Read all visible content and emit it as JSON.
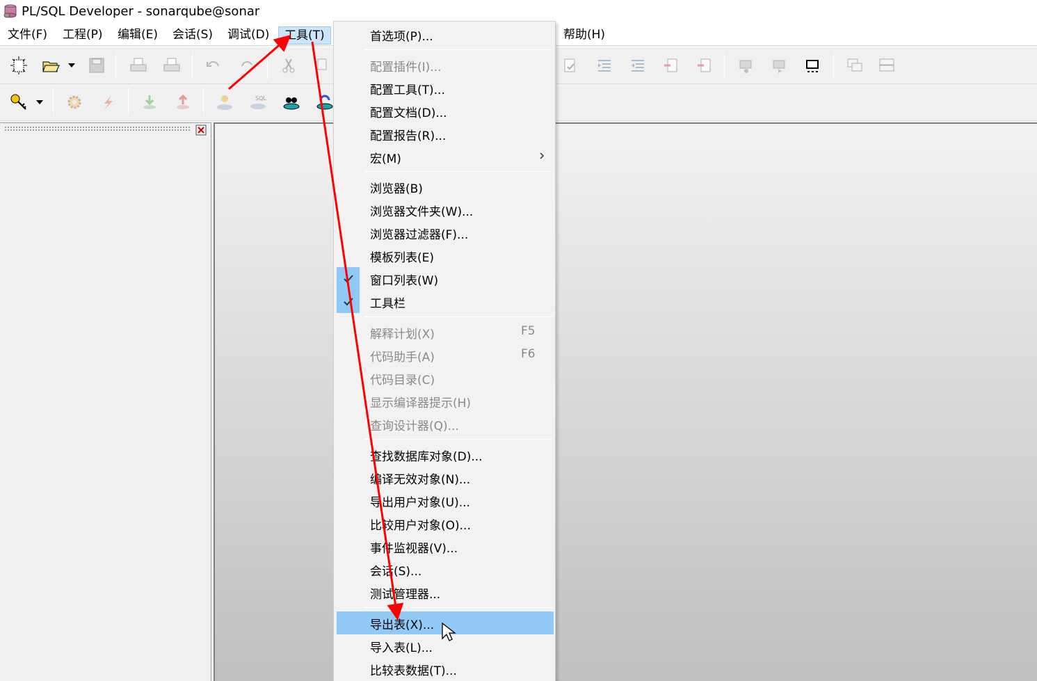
{
  "window": {
    "title": "PL/SQL Developer - sonarqube@sonar"
  },
  "menubar": {
    "items": [
      "文件(F)",
      "工程(P)",
      "编辑(E)",
      "会话(S)",
      "调试(D)",
      "工具(T)",
      "帮助(H)"
    ]
  },
  "tools_menu": {
    "items": [
      {
        "label": "首选项(P)...",
        "enabled": true
      },
      {
        "label": "配置插件(I)...",
        "enabled": false
      },
      {
        "label": "配置工具(T)...",
        "enabled": true
      },
      {
        "label": "配置文档(D)...",
        "enabled": true
      },
      {
        "label": "配置报告(R)...",
        "enabled": true
      },
      {
        "label": "宏(M)",
        "enabled": true,
        "submenu": true
      },
      {
        "label": "浏览器(B)",
        "enabled": true
      },
      {
        "label": "浏览器文件夹(W)...",
        "enabled": true
      },
      {
        "label": "浏览器过滤器(F)...",
        "enabled": true
      },
      {
        "label": "模板列表(E)",
        "enabled": true
      },
      {
        "label": "窗口列表(W)",
        "enabled": true,
        "checked": true
      },
      {
        "label": "工具栏",
        "enabled": true,
        "checked": true
      },
      {
        "label": "解释计划(X)",
        "enabled": false,
        "shortcut": "F5"
      },
      {
        "label": "代码助手(A)",
        "enabled": false,
        "shortcut": "F6"
      },
      {
        "label": "代码目录(C)",
        "enabled": false
      },
      {
        "label": "显示编译器提示(H)",
        "enabled": false
      },
      {
        "label": "查询设计器(Q)...",
        "enabled": false
      },
      {
        "label": "查找数据库对象(D)...",
        "enabled": true
      },
      {
        "label": "编译无效对象(N)...",
        "enabled": true
      },
      {
        "label": "导出用户对象(U)...",
        "enabled": true
      },
      {
        "label": "比较用户对象(O)...",
        "enabled": true
      },
      {
        "label": "事件监视器(V)...",
        "enabled": true
      },
      {
        "label": "会话(S)...",
        "enabled": true
      },
      {
        "label": "测试管理器...",
        "enabled": true
      },
      {
        "label": "导出表(X)...",
        "enabled": true,
        "selected": true
      },
      {
        "label": "导入表(L)...",
        "enabled": true
      },
      {
        "label": "比较表数据(T)...",
        "enabled": true
      }
    ]
  },
  "colors": {
    "menu_highlight": "#91c9f7",
    "menubar_active": "#cce4f7",
    "annotation_arrow": "#ff0000"
  }
}
